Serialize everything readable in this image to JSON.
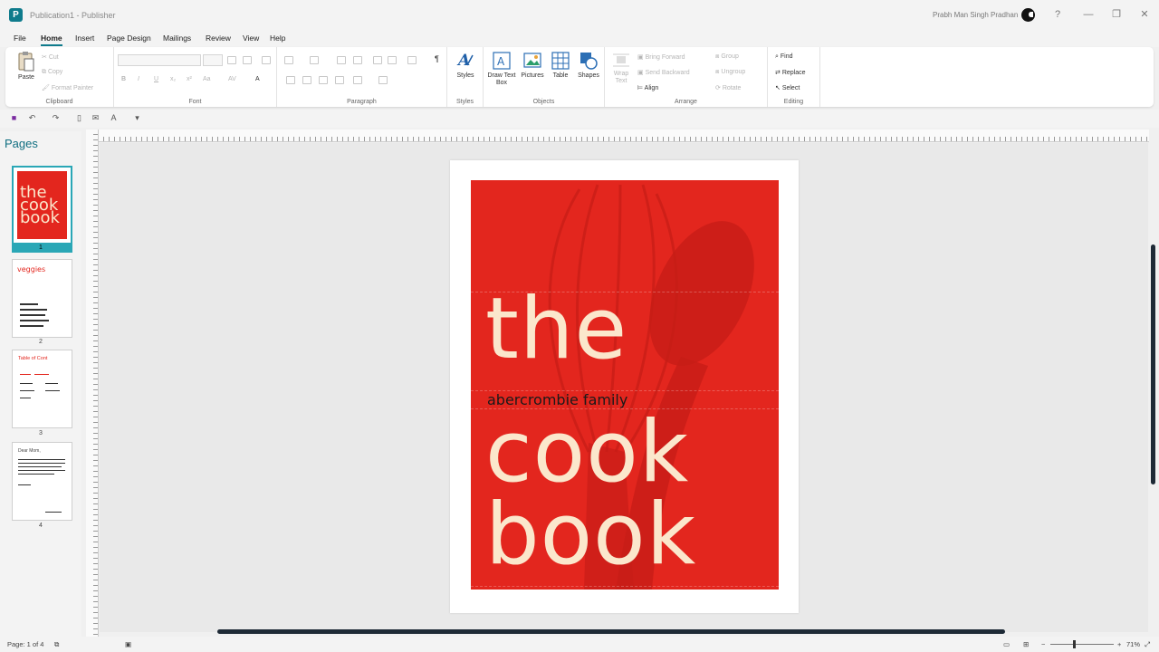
{
  "titlebar": {
    "doc_title": "Publication1 - Publisher",
    "user_name": "Prabh Man Singh Pradhan",
    "help": "?",
    "minimize": "—",
    "restore": "❐",
    "close": "✕"
  },
  "menu": [
    "File",
    "Home",
    "Insert",
    "Page Design",
    "Mailings",
    "Review",
    "View",
    "Help"
  ],
  "ribbon": {
    "clipboard": {
      "label": "Clipboard",
      "paste": "Paste",
      "cut": "Cut",
      "copy": "Copy",
      "format_painter": "Format Painter"
    },
    "font": {
      "label": "Font"
    },
    "paragraph": {
      "label": "Paragraph"
    },
    "styles": {
      "label": "Styles",
      "styles_btn": "Styles"
    },
    "objects": {
      "label": "Objects",
      "draw_text_box": "Draw Text Box",
      "pictures": "Pictures",
      "table": "Table",
      "shapes": "Shapes"
    },
    "arrange": {
      "label": "Arrange",
      "wrap_text": "Wrap Text",
      "bring_forward": "Bring Forward",
      "send_backward": "Send Backward",
      "align": "Align",
      "group": "Group",
      "ungroup": "Ungroup",
      "rotate": "Rotate"
    },
    "editing": {
      "label": "Editing",
      "find": "Find",
      "replace": "Replace",
      "select": "Select"
    }
  },
  "pages_panel": {
    "title": "Pages",
    "pages": [
      {
        "num": "1",
        "preview": [
          "the",
          "cook",
          "book"
        ]
      },
      {
        "num": "2",
        "preview": [
          "veggies"
        ]
      },
      {
        "num": "3",
        "preview": [
          "Table of Cont"
        ]
      },
      {
        "num": "4",
        "preview": [
          "Dear Mom,"
        ]
      }
    ]
  },
  "cover": {
    "word1": "the",
    "subtitle": "abercrombie family",
    "word2": "cook",
    "word3": "book"
  },
  "status": {
    "page": "Page: 1 of 4",
    "zoom": "71%"
  },
  "colors": {
    "accent": "#0f7b8c",
    "cover_red": "#e3261e",
    "cover_text": "#fbe7cc"
  }
}
